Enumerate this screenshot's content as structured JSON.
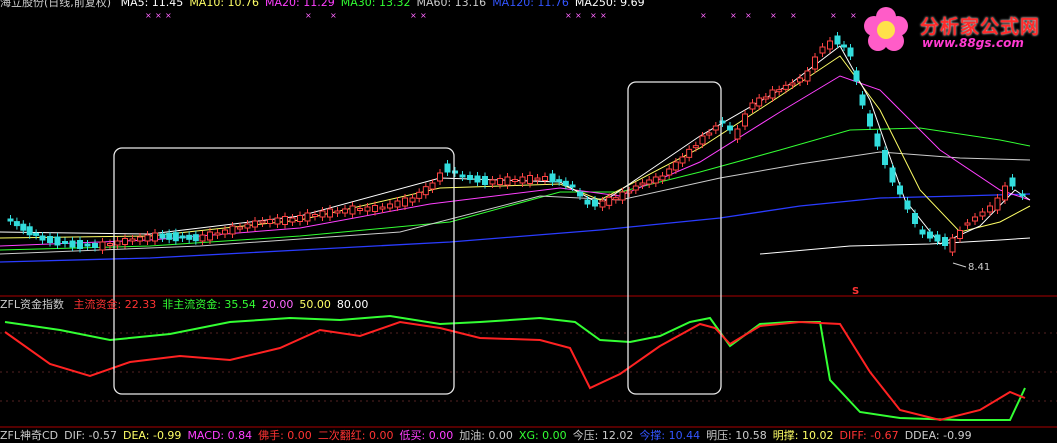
{
  "top": {
    "title": "海立股份(日线,前复权)",
    "ma": [
      {
        "label": "MA5: 11.45",
        "color": "#ffffff"
      },
      {
        "label": "MA10: 10.76",
        "color": "#ffff66"
      },
      {
        "label": "MA20: 11.29",
        "color": "#ff40ff"
      },
      {
        "label": "MA30: 13.32",
        "color": "#33ff33"
      },
      {
        "label": "MA60: 13.16",
        "color": "#cccccc"
      },
      {
        "label": "MA120: 11.76",
        "color": "#3355ff"
      },
      {
        "label": "MA250: 9.69",
        "color": "#ffffff"
      }
    ],
    "low_label": "8.41",
    "marker": "S"
  },
  "mid": {
    "title": "ZFL资金指数",
    "items": [
      {
        "label": "主流资金: 22.33",
        "color": "#ff3333"
      },
      {
        "label": "非主流资金: 35.54",
        "color": "#33ff33"
      },
      {
        "label": "20.00",
        "color": "#ff66ff"
      },
      {
        "label": "50.00",
        "color": "#ffff66"
      },
      {
        "label": "80.00",
        "color": "#ffffff"
      }
    ]
  },
  "bottom": {
    "items": [
      {
        "label": "ZFL神奇CD",
        "color": "#cccccc"
      },
      {
        "label": "DIF: -0.57",
        "color": "#cccccc"
      },
      {
        "label": "DEA: -0.99",
        "color": "#ffff66"
      },
      {
        "label": "MACD: 0.84",
        "color": "#ff40ff"
      },
      {
        "label": "佛手: 0.00",
        "color": "#ff3333"
      },
      {
        "label": "二次翻红: 0.00",
        "color": "#ff3333"
      },
      {
        "label": "低买: 0.00",
        "color": "#ff40ff"
      },
      {
        "label": "加油: 0.00",
        "color": "#cccccc"
      },
      {
        "label": "XG: 0.00",
        "color": "#33ff33"
      },
      {
        "label": "今压: 12.02",
        "color": "#cccccc"
      },
      {
        "label": "今撑: 10.44",
        "color": "#3355ff"
      },
      {
        "label": "明压: 10.58",
        "color": "#cccccc"
      },
      {
        "label": "明撑: 10.02",
        "color": "#ffff66"
      },
      {
        "label": "DIFF: -0.67",
        "color": "#ff3333"
      },
      {
        "label": "DDEA: -0.99",
        "color": "#cccccc"
      }
    ]
  },
  "logo": {
    "name": "分析家公式网",
    "url": "www.88gs.com"
  }
}
